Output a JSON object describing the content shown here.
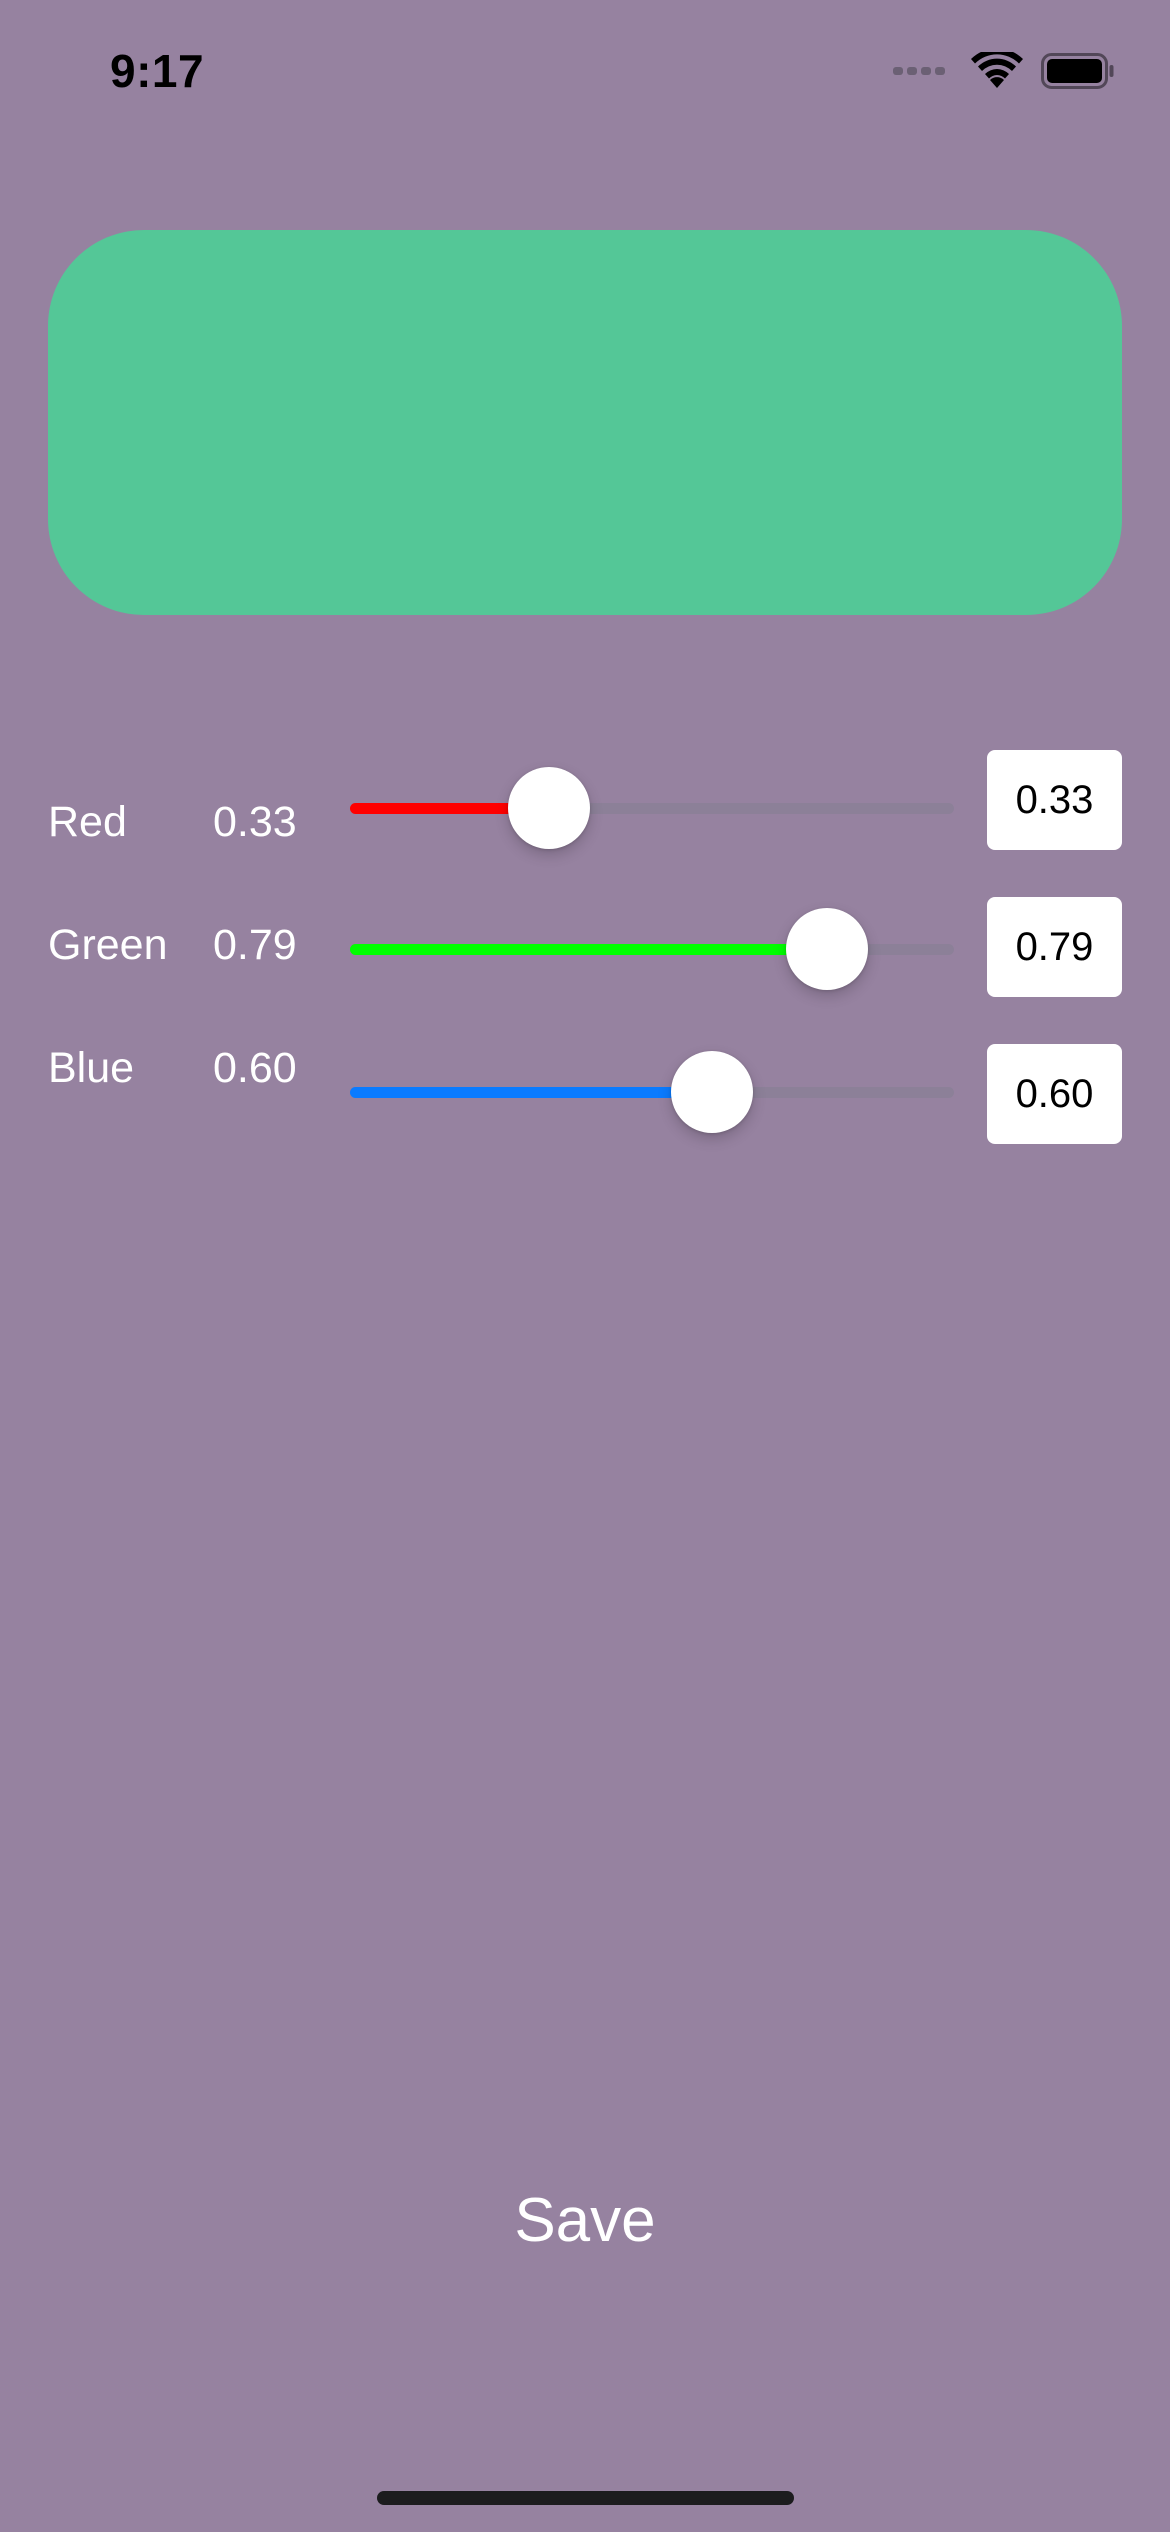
{
  "status_bar": {
    "time": "9:17",
    "icons": [
      "signal-dots-icon",
      "wifi-icon",
      "battery-icon"
    ]
  },
  "colors": {
    "background": "#9682a0",
    "preview": "#54c797",
    "red_track": "#ff0000",
    "green_track": "#00ff00",
    "blue_track": "#0a7bff"
  },
  "sliders": [
    {
      "label": "Red",
      "value": "0.33",
      "field_value": "0.33",
      "fraction": 0.33
    },
    {
      "label": "Green",
      "value": "0.79",
      "field_value": "0.79",
      "fraction": 0.79
    },
    {
      "label": "Blue",
      "value": "0.60",
      "field_value": "0.60",
      "fraction": 0.6
    }
  ],
  "save_label": "Save"
}
